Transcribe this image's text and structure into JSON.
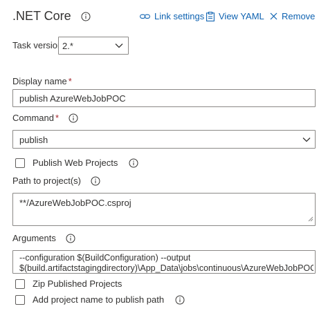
{
  "header": {
    "title": ".NET Core",
    "link_settings_label": "Link settings",
    "view_yaml_label": "View YAML",
    "remove_label": "Remove"
  },
  "task_version": {
    "label": "Task version",
    "value": "2.*"
  },
  "display_name": {
    "label": "Display name",
    "required_mark": "*",
    "value": "publish AzureWebJobPOC"
  },
  "command": {
    "label": "Command",
    "required_mark": "*",
    "value": "publish"
  },
  "publish_web_projects": {
    "label": "Publish Web Projects",
    "checked": false
  },
  "path_to_projects": {
    "label": "Path to project(s)",
    "value": "**/AzureWebJobPOC.csproj"
  },
  "arguments": {
    "label": "Arguments",
    "line1": "--configuration $(BuildConfiguration) --output",
    "line2": "$(build.artifactstagingdirectory)\\App_Data\\jobs\\continuous\\AzureWebJobPOC\\"
  },
  "zip_published_projects": {
    "label": "Zip Published Projects",
    "checked": false
  },
  "add_project_name": {
    "label": "Add project name to publish path",
    "checked": false
  },
  "colors": {
    "link": "#0e62b1",
    "text": "#323130",
    "border": "#8a8886",
    "required": "#a4262c"
  }
}
